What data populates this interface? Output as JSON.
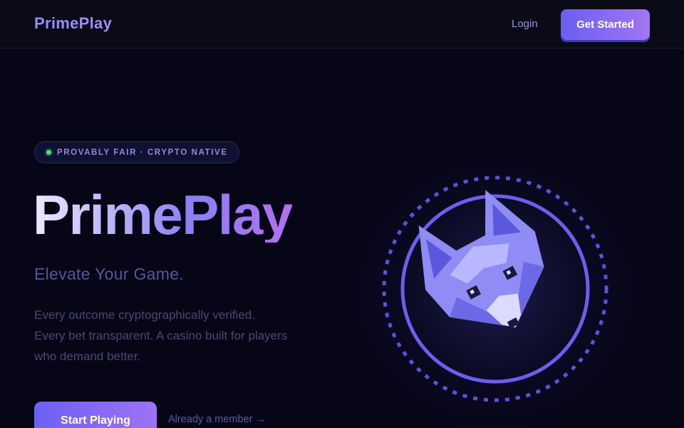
{
  "nav": {
    "brand": "PrimePlay",
    "login": "Login",
    "cta": "Get Started"
  },
  "hero": {
    "badge": "PROVABLY FAIR · CRYPTO NATIVE",
    "title": "PrimePlay",
    "subtitle": "Elevate Your Game.",
    "description_lines": [
      "Every outcome cryptographically verified.",
      "Every bet transparent. A casino built for players",
      "who demand better."
    ],
    "primary_button": "Start Playing",
    "secondary_link": "Already a member →"
  },
  "emblem": {
    "icon": "pixel-fox-icon"
  },
  "colors": {
    "background": "#070617",
    "navbar": "#0a0b16",
    "accent_start": "#6b5ff4",
    "accent_end": "#a374f5",
    "ring": "#5e55e8",
    "status_dot": "#4ade80"
  }
}
